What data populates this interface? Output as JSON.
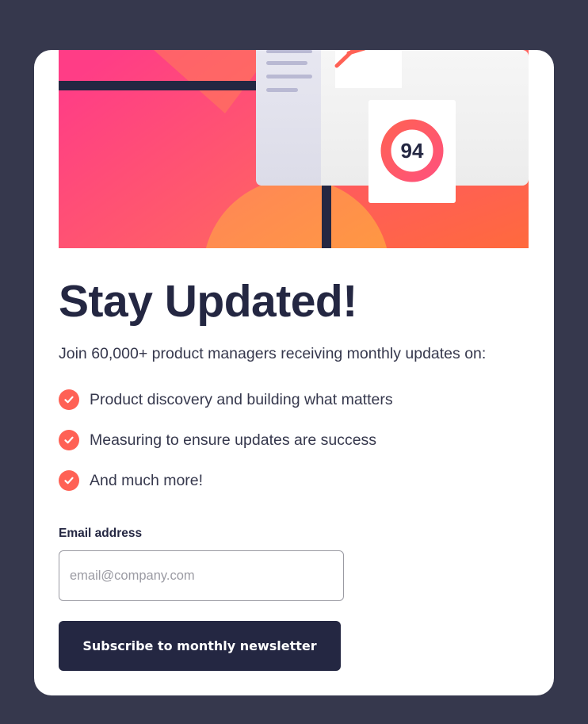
{
  "hero": {
    "illustration": "dashboard-illustration",
    "score": "94"
  },
  "content": {
    "title": "Stay Updated!",
    "intro": "Join 60,000+ product managers receiving monthly updates on:",
    "features": [
      "Product discovery and building what matters",
      "Measuring to ensure updates are success",
      "And much more!"
    ],
    "feature_icon": "check-icon"
  },
  "form": {
    "email_label": "Email address",
    "email_value": "",
    "email_placeholder": "email@company.com",
    "submit_label": "Subscribe to monthly newsletter"
  },
  "colors": {
    "page_background": "#36384d",
    "card_background": "#ffffff",
    "heading": "#242742",
    "body_text": "#36384d",
    "accent": "#ff6155",
    "accent_pink": "#ff527b",
    "button": "#242742"
  }
}
